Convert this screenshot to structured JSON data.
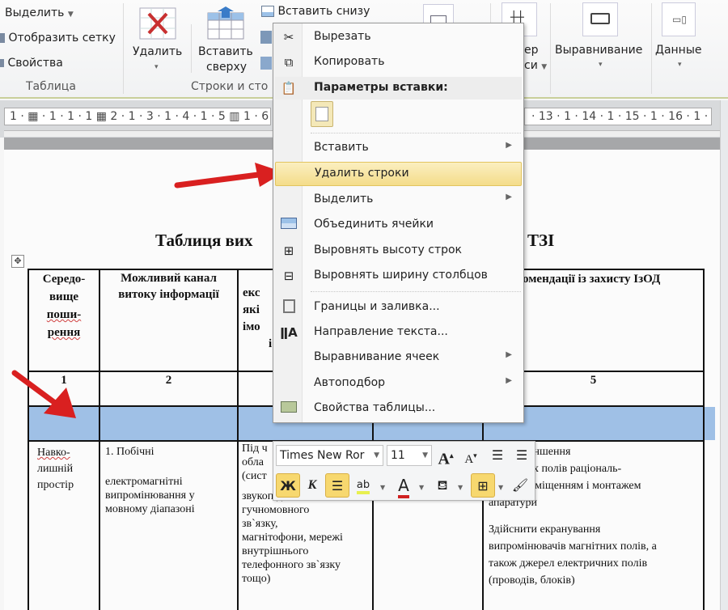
{
  "ribbon": {
    "table_group": {
      "select": "Выделить",
      "show_grid": "Отобразить сетку",
      "properties": "Свойства",
      "label": "Таблица"
    },
    "rows_cols_group": {
      "delete": "Удалить",
      "insert_above_line1": "Вставить",
      "insert_above_line2": "сверху",
      "insert_below": "Вставить снизу",
      "label": "Строки и сто"
    },
    "cell_size_partial_1": "ер",
    "cell_size_partial_2": "си",
    "alignment": "Выравнивание",
    "data": "Данные"
  },
  "ruler": {
    "left_ticks": "1 · ▦ · 1 · 1 · 1 ▦ 2 · 1 · 3 · 1 · 4 · 1 · 5 ▥ 1 · 6",
    "right_ticks": "· 13 · 1 · 14 · 1 · 15 · 1 · 16 · 1 · 1"
  },
  "document": {
    "title_left": "Таблиця вих",
    "title_right": "ТЗІ",
    "headers": {
      "col1": [
        "Середо-",
        "вище",
        "поши-",
        "рення"
      ],
      "col2": [
        "Можливий канал",
        "витоку інформації"
      ],
      "col3_fragment": [
        "екс",
        "які",
        "імо",
        "і"
      ],
      "col5_fragment": "омендації із захисту ІзОД"
    },
    "numbers": [
      "1",
      "2",
      "5"
    ],
    "row1": {
      "col1": [
        "Навко-",
        "лишній",
        "простір"
      ],
      "col2_a": "1. Побічні",
      "col2_b": [
        "електромагнітні",
        "випромінювання у",
        "мовному діапазоні"
      ],
      "col3": [
        "Під ч",
        "обла",
        "(сист",
        "звукопідсилення,",
        "гучномовного",
        "зв`язку,",
        "магнітофони, мережі",
        "внутрішнього",
        "телефонного зв`язку",
        "тощо)"
      ],
      "col5": [
        "...ити зменшення",
        "...агнітних полів раціональ-",
        "...ним розміщенням і монтажем",
        "апаратури",
        "Здійснити екранування",
        "випромінювачів магнітних полів, а",
        "також джерел електричних полів",
        "(проводів, блоків)"
      ]
    }
  },
  "context_menu": {
    "items": [
      {
        "label": "Вырезать",
        "icon": "scissors-icon"
      },
      {
        "label": "Копировать",
        "icon": "copy-icon"
      },
      {
        "label": "Параметры вставки:",
        "icon": "paste-icon"
      },
      {
        "label": "Вставить",
        "submenu": true
      },
      {
        "label": "Удалить строки",
        "highlighted": true
      },
      {
        "label": "Выделить",
        "submenu": true
      },
      {
        "label": "Объединить ячейки",
        "icon": "merge-cells-icon"
      },
      {
        "label": "Выровнять высоту строк",
        "icon": "distribute-rows-icon"
      },
      {
        "label": "Выровнять ширину столбцов",
        "icon": "distribute-columns-icon"
      },
      {
        "label": "Границы и заливка...",
        "icon": "borders-icon"
      },
      {
        "label": "Направление текста...",
        "icon": "text-direction-icon"
      },
      {
        "label": "Выравнивание ячеек",
        "submenu": true
      },
      {
        "label": "Автоподбор",
        "submenu": true
      },
      {
        "label": "Свойства таблицы...",
        "icon": "table-properties-icon"
      }
    ],
    "submenu_glyph": "▶"
  },
  "mini_toolbar": {
    "font": "Times New Ror",
    "size": "11",
    "grow": "A",
    "shrink": "A",
    "bold": "Ж",
    "italic": "К",
    "highlight": "ab",
    "font_color": "A"
  },
  "colors": {
    "selection": "#9fc0e6",
    "menu_highlight": "#f4dc8a",
    "arrow": "#d92020"
  }
}
